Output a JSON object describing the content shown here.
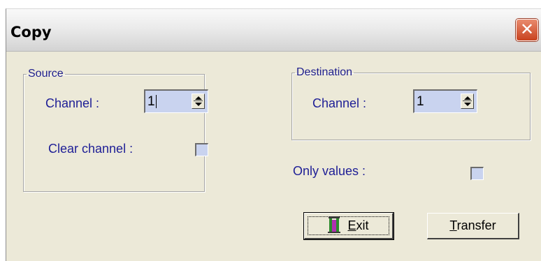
{
  "window": {
    "title": "Copy",
    "close_glyph": "✕"
  },
  "source": {
    "legend": "Source",
    "channel_label": "Channel :",
    "channel_value": "1",
    "clear_label": "Clear channel :",
    "clear_checked": false
  },
  "destination": {
    "legend": "Destination",
    "channel_label": "Channel :",
    "channel_value": "1"
  },
  "options": {
    "only_values_label": "Only values :",
    "only_values_checked": false
  },
  "buttons": {
    "exit": {
      "underline": "E",
      "rest": "xit",
      "icon": "exit-door-icon"
    },
    "transfer": {
      "underline": "T",
      "rest": "ransfer"
    }
  },
  "colors": {
    "label": "#1e1e96",
    "field_bg": "#c9d3ef",
    "dialog_bg": "#ece9d8",
    "close_red": "#c8421f"
  }
}
